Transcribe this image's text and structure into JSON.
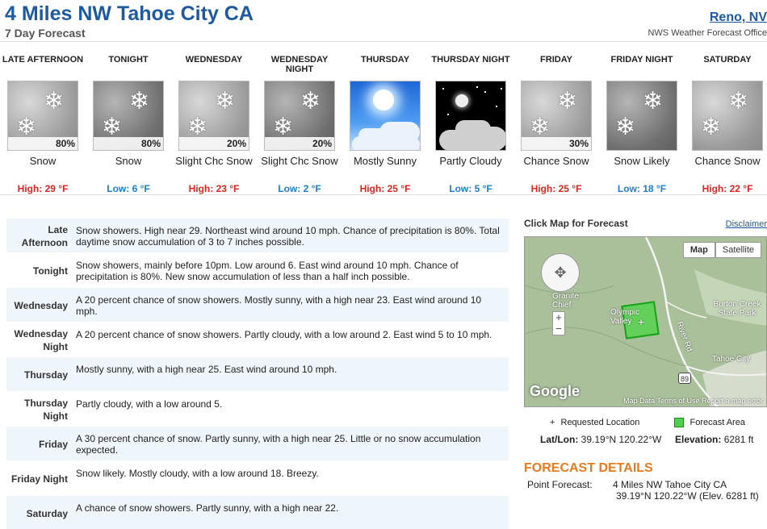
{
  "header": {
    "title": "4 Miles NW Tahoe City CA",
    "subtitle": "7 Day Forecast",
    "office_link": "Reno, NV",
    "office_name": "NWS Weather Forecast Office"
  },
  "periods": [
    {
      "name": "Late Afternoon",
      "icon": "snow-icon",
      "pop": "80%",
      "desc": "Snow",
      "temp": "High: 29 °F",
      "kind": "high"
    },
    {
      "name": "Tonight",
      "icon": "snow-night-icon",
      "pop": "80%",
      "desc": "Snow",
      "temp": "Low: 6 °F",
      "kind": "low"
    },
    {
      "name": "Wednesday",
      "icon": "snow-icon",
      "pop": "20%",
      "desc": "Slight Chc Snow",
      "temp": "High: 23 °F",
      "kind": "high"
    },
    {
      "name": "Wednesday Night",
      "icon": "snow-night-icon",
      "pop": "20%",
      "desc": "Slight Chc Snow",
      "temp": "Low: 2 °F",
      "kind": "low"
    },
    {
      "name": "Thursday",
      "icon": "mostly-sunny-icon",
      "pop": "",
      "desc": "Mostly Sunny",
      "temp": "High: 25 °F",
      "kind": "high"
    },
    {
      "name": "Thursday Night",
      "icon": "partly-cloudy-night-icon",
      "pop": "",
      "desc": "Partly Cloudy",
      "temp": "Low: 5 °F",
      "kind": "low"
    },
    {
      "name": "Friday",
      "icon": "snow-icon",
      "pop": "30%",
      "desc": "Chance Snow",
      "temp": "High: 25 °F",
      "kind": "high"
    },
    {
      "name": "Friday Night",
      "icon": "snow-night-icon",
      "pop": "",
      "desc": "Snow Likely",
      "temp": "Low: 18 °F",
      "kind": "low"
    },
    {
      "name": "Saturday",
      "icon": "snow-icon",
      "pop": "",
      "desc": "Chance Snow",
      "temp": "High: 22 °F",
      "kind": "high"
    }
  ],
  "details": [
    {
      "label": "Late Afternoon",
      "text": "Snow showers. High near 29. Northeast wind around 10 mph. Chance of precipitation is 80%. Total daytime snow accumulation of 3 to 7 inches possible."
    },
    {
      "label": "Tonight",
      "text": "Snow showers, mainly before 10pm. Low around 6. East wind around 10 mph. Chance of precipitation is 80%. New snow accumulation of less than a half inch possible."
    },
    {
      "label": "Wednesday",
      "text": "A 20 percent chance of snow showers. Mostly sunny, with a high near 23. East wind around 10 mph."
    },
    {
      "label": "Wednesday Night",
      "text": "A 20 percent chance of snow showers. Partly cloudy, with a low around 2. East wind 5 to 10 mph."
    },
    {
      "label": "Thursday",
      "text": "Mostly sunny, with a high near 25. East wind around 10 mph."
    },
    {
      "label": "Thursday Night",
      "text": "Partly cloudy, with a low around 5."
    },
    {
      "label": "Friday",
      "text": "A 30 percent chance of snow. Partly sunny, with a high near 25. Little or no snow accumulation expected."
    },
    {
      "label": "Friday Night",
      "text": "Snow likely. Mostly cloudy, with a low around 18. Breezy."
    },
    {
      "label": "Saturday",
      "text": "A chance of snow showers. Partly sunny, with a high near 22."
    }
  ],
  "map": {
    "title": "Click Map for Forecast",
    "disclaimer": "Disclaimer",
    "btn_map": "Map",
    "btn_satellite": "Satellite",
    "labels": {
      "granite_chief": "Granite Chief",
      "olympic_valley": "Olympic Valley",
      "burton_creek": "Burton Creek State Park",
      "tahoe_city": "Tahoe City",
      "river_rd": "River Rd",
      "hwy": "89"
    },
    "google": "Google",
    "terms": "Map Data   Terms of Use   Report a map error",
    "legend_requested": "Requested Location",
    "legend_area": "Forecast Area",
    "latlon_label": "Lat/Lon:",
    "latlon_value": "39.19°N 120.22°W",
    "elev_label": "Elevation:",
    "elev_value": "6281 ft"
  },
  "forecast_details": {
    "heading": "FORECAST DETAILS",
    "point_label": "Point Forecast:",
    "point_value": "4 Miles NW Tahoe City CA",
    "point_coords": "39.19°N 120.22°W (Elev. 6281 ft)"
  },
  "colors": {
    "title_blue": "#1d5aa0",
    "high_red": "#e3231c",
    "low_blue": "#1a7fd6",
    "orange_heading": "#e87a1e"
  }
}
